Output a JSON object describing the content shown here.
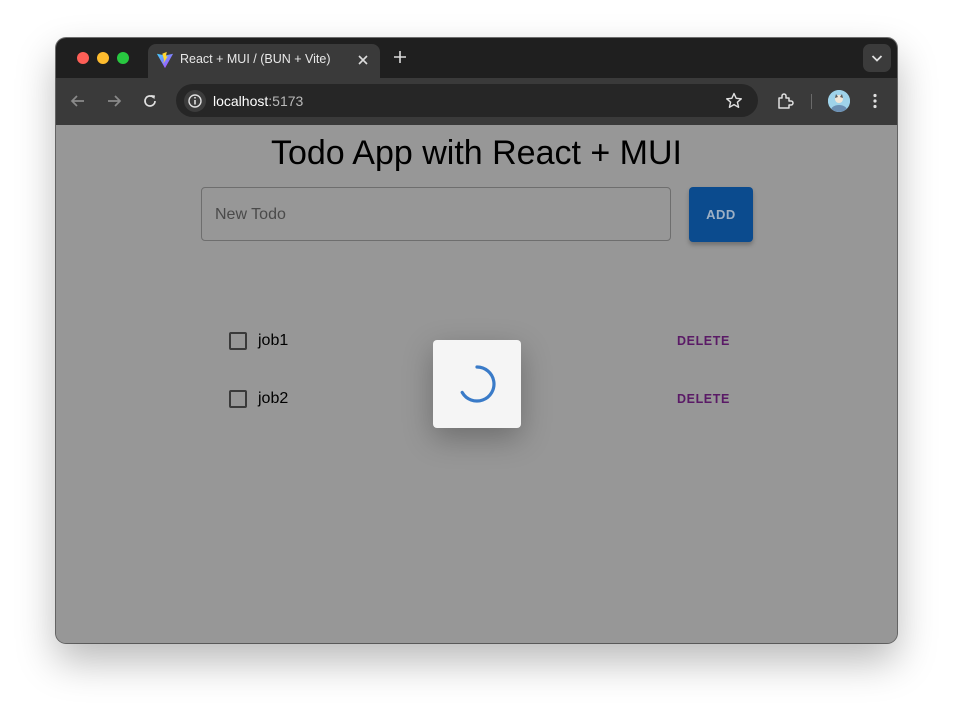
{
  "browser": {
    "tab_title": "React + MUI / (BUN + Vite)",
    "url_host": "localhost",
    "url_port": ":5173",
    "icons": [
      "vite-favicon-icon",
      "close-icon",
      "plus-icon",
      "chevron-down-icon",
      "back-arrow-icon",
      "forward-arrow-icon",
      "reload-icon",
      "site-info-icon",
      "star-icon",
      "extensions-icon",
      "profile-avatar",
      "more-vert-icon"
    ],
    "colors": {
      "traffic_red": "#fe5f57",
      "traffic_yellow": "#febc2e",
      "traffic_green": "#28c840"
    }
  },
  "app": {
    "title": "Todo App with React + MUI",
    "input": {
      "placeholder": "New Todo",
      "value": ""
    },
    "add_label": "ADD",
    "todos": [
      {
        "label": "job1",
        "checked": false,
        "delete_label": "DELETE"
      },
      {
        "label": "job2",
        "checked": false,
        "delete_label": "DELETE"
      }
    ],
    "loading": true,
    "colors": {
      "primary": "#0b4b8e",
      "delete": "#5a1a66",
      "spinner": "#3a7bc8",
      "backdrop": "#979797"
    }
  }
}
